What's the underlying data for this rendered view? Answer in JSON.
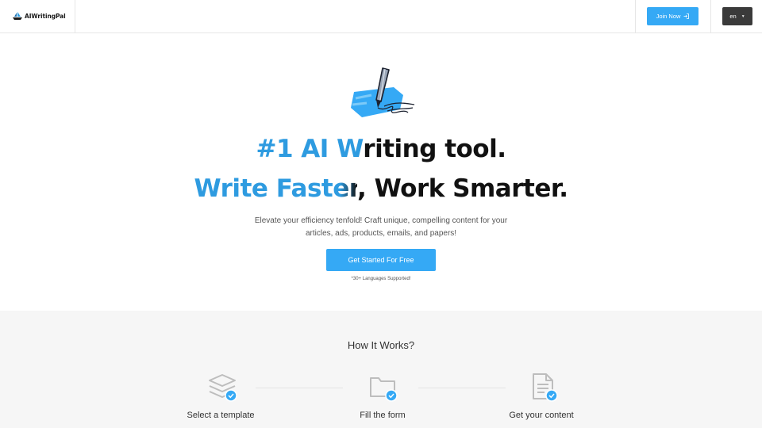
{
  "header": {
    "logo_text": "AIWritingPal",
    "join_label": "Join Now",
    "lang_label": "en"
  },
  "hero": {
    "line1_prefix": "#1 AI W",
    "line1_rest": "riting tool.",
    "line2_blue": "Write Fast",
    "line2_fade": "er",
    "line2_rest": ", Work Smarter.",
    "sub_line1": "Elevate your efficiency tenfold! Craft unique, compelling content for your",
    "sub_line2": "articles, ads, products, emails, and papers!",
    "cta_label": "Get Started For Free",
    "note": "*30+ Languages Supported!"
  },
  "how": {
    "title": "How It Works?",
    "steps": [
      {
        "label": "Select a template",
        "icon": "layers-icon"
      },
      {
        "label": "Fill the form",
        "icon": "folder-icon"
      },
      {
        "label": "Get your content",
        "icon": "document-icon"
      }
    ]
  },
  "colors": {
    "accent": "#35a9f5",
    "headline_blue": "#2e9be0",
    "dark": "#3a3a3a",
    "section_bg": "#f6f6f6"
  }
}
